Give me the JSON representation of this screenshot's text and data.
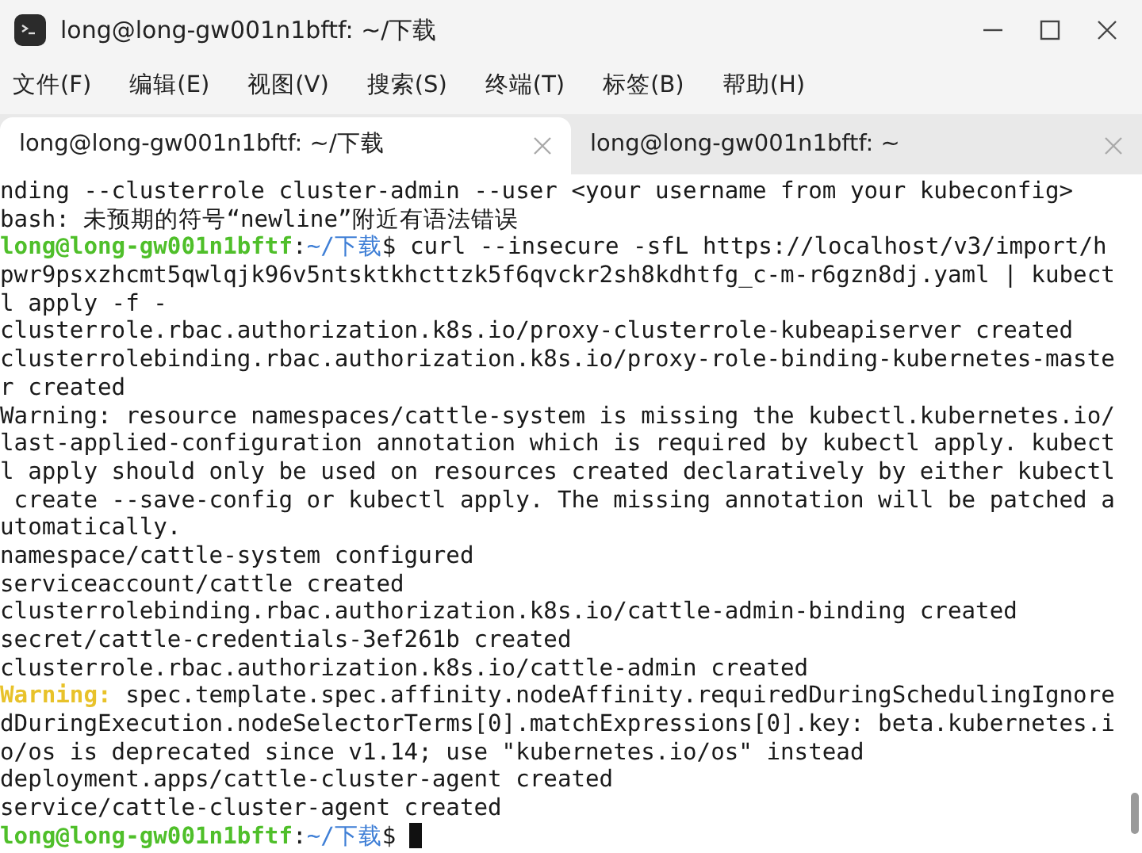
{
  "window": {
    "title": "long@long-gw001n1bftf: ~/下载"
  },
  "menu": [
    "文件(F)",
    "编辑(E)",
    "视图(V)",
    "搜索(S)",
    "终端(T)",
    "标签(B)",
    "帮助(H)"
  ],
  "tabs": [
    {
      "label": "long@long-gw001n1bftf: ~/下载",
      "selected": true
    },
    {
      "label": "long@long-gw001n1bftf: ~",
      "selected": false
    }
  ],
  "terminal": {
    "lines": [
      [
        {
          "kind": "text",
          "text": "nding --clusterrole cluster-admin --user <your username from your kubeconfig>"
        }
      ],
      [
        {
          "kind": "text",
          "text": "bash: 未预期的符号“newline”附近有语法错误"
        }
      ],
      [
        {
          "kind": "user",
          "text": "long@long-gw001n1bftf"
        },
        {
          "kind": "text",
          "text": ":"
        },
        {
          "kind": "path",
          "text": "~/下载"
        },
        {
          "kind": "text",
          "text": "$ curl --insecure -sfL https://localhost/v3/import/h"
        }
      ],
      [
        {
          "kind": "text",
          "text": "pwr9psxzhcmt5qwlqjk96v5ntsktkhcttzk5f6qvckr2sh8kdhtfg_c-m-r6gzn8dj.yaml | kubect"
        }
      ],
      [
        {
          "kind": "text",
          "text": "l apply -f -"
        }
      ],
      [
        {
          "kind": "text",
          "text": "clusterrole.rbac.authorization.k8s.io/proxy-clusterrole-kubeapiserver created"
        }
      ],
      [
        {
          "kind": "text",
          "text": "clusterrolebinding.rbac.authorization.k8s.io/proxy-role-binding-kubernetes-maste"
        }
      ],
      [
        {
          "kind": "text",
          "text": "r created"
        }
      ],
      [
        {
          "kind": "text",
          "text": "Warning: resource namespaces/cattle-system is missing the kubectl.kubernetes.io/"
        }
      ],
      [
        {
          "kind": "text",
          "text": "last-applied-configuration annotation which is required by kubectl apply. kubect"
        }
      ],
      [
        {
          "kind": "text",
          "text": "l apply should only be used on resources created declaratively by either kubectl"
        }
      ],
      [
        {
          "kind": "text",
          "text": " create --save-config or kubectl apply. The missing annotation will be patched a"
        }
      ],
      [
        {
          "kind": "text",
          "text": "utomatically."
        }
      ],
      [
        {
          "kind": "text",
          "text": "namespace/cattle-system configured"
        }
      ],
      [
        {
          "kind": "text",
          "text": "serviceaccount/cattle created"
        }
      ],
      [
        {
          "kind": "text",
          "text": "clusterrolebinding.rbac.authorization.k8s.io/cattle-admin-binding created"
        }
      ],
      [
        {
          "kind": "text",
          "text": "secret/cattle-credentials-3ef261b created"
        }
      ],
      [
        {
          "kind": "text",
          "text": "clusterrole.rbac.authorization.k8s.io/cattle-admin created"
        }
      ],
      [
        {
          "kind": "warning",
          "text": "Warning:"
        },
        {
          "kind": "text",
          "text": " spec.template.spec.affinity.nodeAffinity.requiredDuringSchedulingIgnore"
        }
      ],
      [
        {
          "kind": "text",
          "text": "dDuringExecution.nodeSelectorTerms[0].matchExpressions[0].key: beta.kubernetes.i"
        }
      ],
      [
        {
          "kind": "text",
          "text": "o/os is deprecated since v1.14; use \"kubernetes.io/os\" instead"
        }
      ],
      [
        {
          "kind": "text",
          "text": "deployment.apps/cattle-cluster-agent created"
        }
      ],
      [
        {
          "kind": "text",
          "text": "service/cattle-cluster-agent created"
        }
      ],
      [
        {
          "kind": "user",
          "text": "long@long-gw001n1bftf"
        },
        {
          "kind": "text",
          "text": ":"
        },
        {
          "kind": "path",
          "text": "~/下载"
        },
        {
          "kind": "text",
          "text": "$ "
        }
      ]
    ]
  }
}
